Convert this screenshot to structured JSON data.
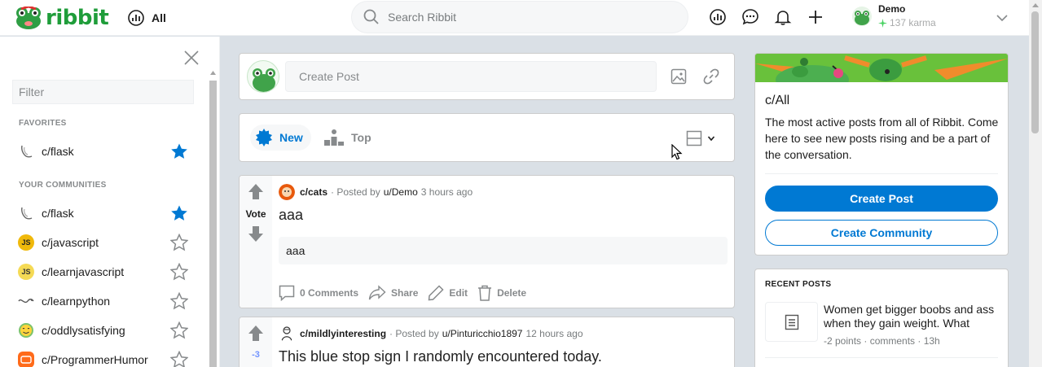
{
  "header": {
    "logo_text": "ribbit",
    "feed_label": "All",
    "search_placeholder": "Search Ribbit",
    "user": {
      "name": "Demo",
      "karma": "137 karma"
    }
  },
  "sidebar": {
    "filter_placeholder": "Filter",
    "favorites_label": "FAVORITES",
    "favorites": [
      {
        "name": "c/flask",
        "icon": "flask-icon",
        "starred": true
      }
    ],
    "communities_label": "YOUR COMMUNITIES",
    "communities": [
      {
        "name": "c/flask",
        "icon": "flask-icon",
        "starred": true
      },
      {
        "name": "c/javascript",
        "icon": "js-icon",
        "starred": false
      },
      {
        "name": "c/learnjavascript",
        "icon": "js-icon",
        "starred": false
      },
      {
        "name": "c/learnpython",
        "icon": "python-icon",
        "starred": false
      },
      {
        "name": "c/oddlysatisfying",
        "icon": "smiley-icon",
        "starred": false
      },
      {
        "name": "c/ProgrammerHumor",
        "icon": "humor-icon",
        "starred": false
      }
    ],
    "js_badge": "JS"
  },
  "create_post": {
    "placeholder": "Create Post"
  },
  "sort": {
    "new_label": "New",
    "top_label": "Top"
  },
  "posts": [
    {
      "community": "c/cats",
      "posted_by": "· Posted by",
      "author": "u/Demo",
      "time": "3 hours ago",
      "vote_label": "Vote",
      "title": "aaa",
      "body": "aaa",
      "actions": {
        "comments": "0 Comments",
        "share": "Share",
        "edit": "Edit",
        "delete": "Delete"
      }
    },
    {
      "community": "c/mildlyinteresting",
      "posted_by": "· Posted by",
      "author": "u/Pinturicchio1897",
      "time": "12 hours ago",
      "vote_label": "-3",
      "title": "This blue stop sign I randomly encountered today."
    }
  ],
  "about": {
    "title": "c/All",
    "description": "The most active posts from all of Ribbit. Come here to see new posts rising and be a part of the conversation.",
    "create_post_label": "Create Post",
    "create_community_label": "Create Community"
  },
  "recent": {
    "label": "RECENT POSTS",
    "items": [
      {
        "title": "Women get bigger boobs and ass when they gain weight. What",
        "meta": "-2 points · comments · 13h"
      }
    ]
  },
  "colors": {
    "brand_green": "#1f9d3a",
    "accent_blue": "#0079d3",
    "page_bg": "#dae0e6"
  }
}
